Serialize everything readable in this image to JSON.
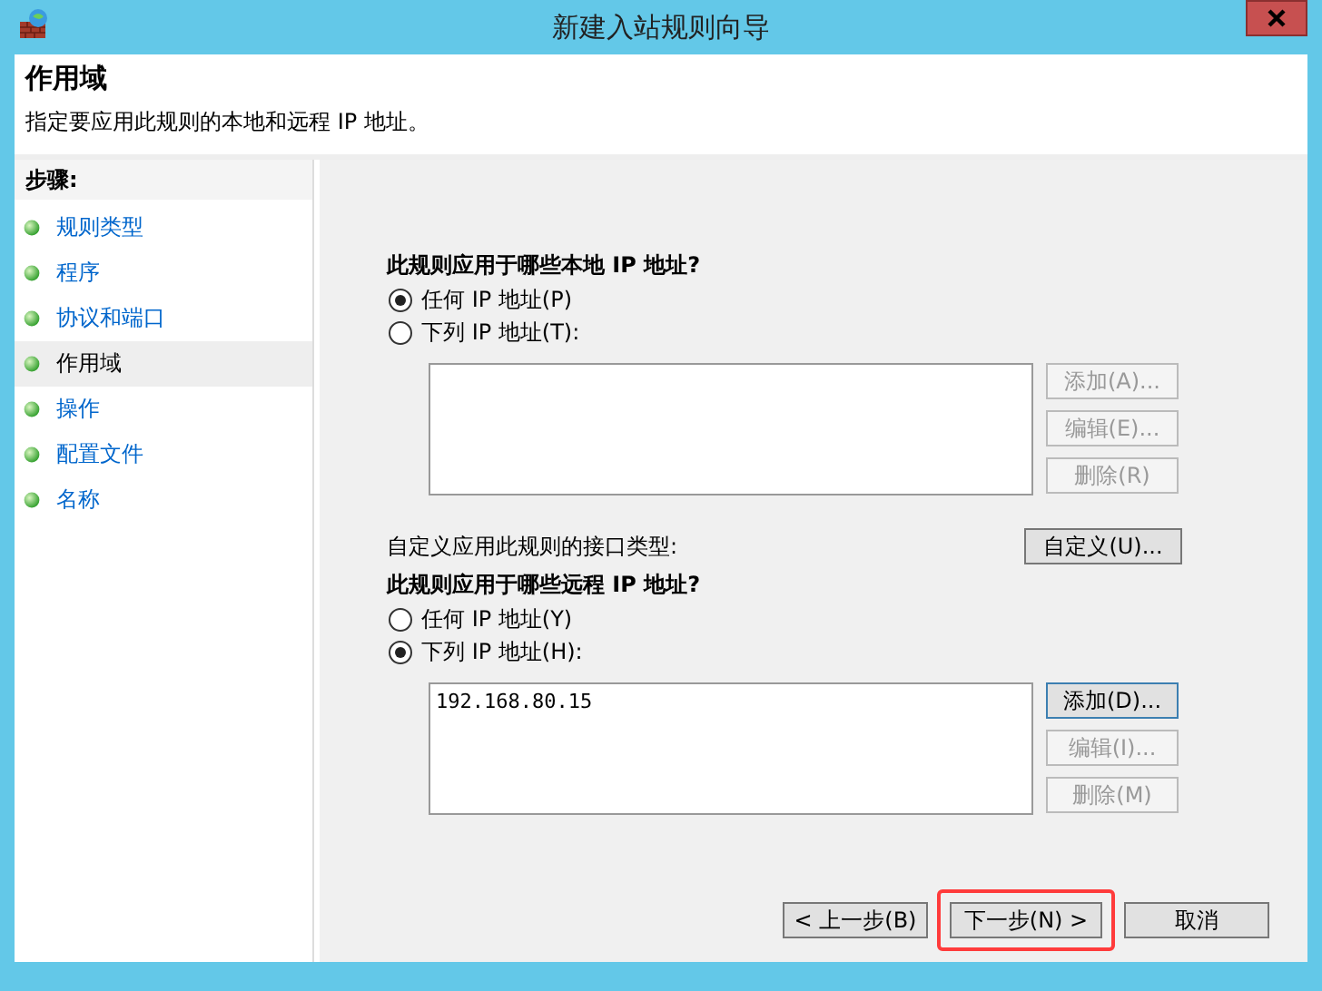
{
  "window": {
    "title": "新建入站规则向导"
  },
  "header": {
    "title": "作用域",
    "description": "指定要应用此规则的本地和远程 IP 地址。"
  },
  "steps": {
    "heading": "步骤:",
    "items": [
      {
        "label": "规则类型",
        "selected": false
      },
      {
        "label": "程序",
        "selected": false
      },
      {
        "label": "协议和端口",
        "selected": false
      },
      {
        "label": "作用域",
        "selected": true
      },
      {
        "label": "操作",
        "selected": false
      },
      {
        "label": "配置文件",
        "selected": false
      },
      {
        "label": "名称",
        "selected": false
      }
    ]
  },
  "local": {
    "question": "此规则应用于哪些本地 IP 地址?",
    "options": [
      {
        "label": "任何 IP 地址(P)",
        "selected": true
      },
      {
        "label": "下列 IP 地址(T):",
        "selected": false
      }
    ],
    "buttons": [
      {
        "label": "添加(A)...",
        "disabled": true,
        "focused": false
      },
      {
        "label": "编辑(E)...",
        "disabled": true,
        "focused": false
      },
      {
        "label": "删除(R)",
        "disabled": true,
        "focused": false
      }
    ]
  },
  "interface": {
    "label": "自定义应用此规则的接口类型:",
    "button": "自定义(U)..."
  },
  "remote": {
    "question": "此规则应用于哪些远程 IP 地址?",
    "options": [
      {
        "label": "任何 IP 地址(Y)",
        "selected": false
      },
      {
        "label": "下列 IP 地址(H):",
        "selected": true
      }
    ],
    "addresses": [
      "192.168.80.15"
    ],
    "buttons": [
      {
        "label": "添加(D)...",
        "disabled": false,
        "focused": true
      },
      {
        "label": "编辑(I)...",
        "disabled": true,
        "focused": false
      },
      {
        "label": "删除(M)",
        "disabled": true,
        "focused": false
      }
    ]
  },
  "footer": {
    "buttons": [
      {
        "label": "< 上一步(B)",
        "highlighted": false
      },
      {
        "label": "下一步(N) >",
        "highlighted": true
      },
      {
        "label": "取消",
        "highlighted": false
      }
    ]
  }
}
